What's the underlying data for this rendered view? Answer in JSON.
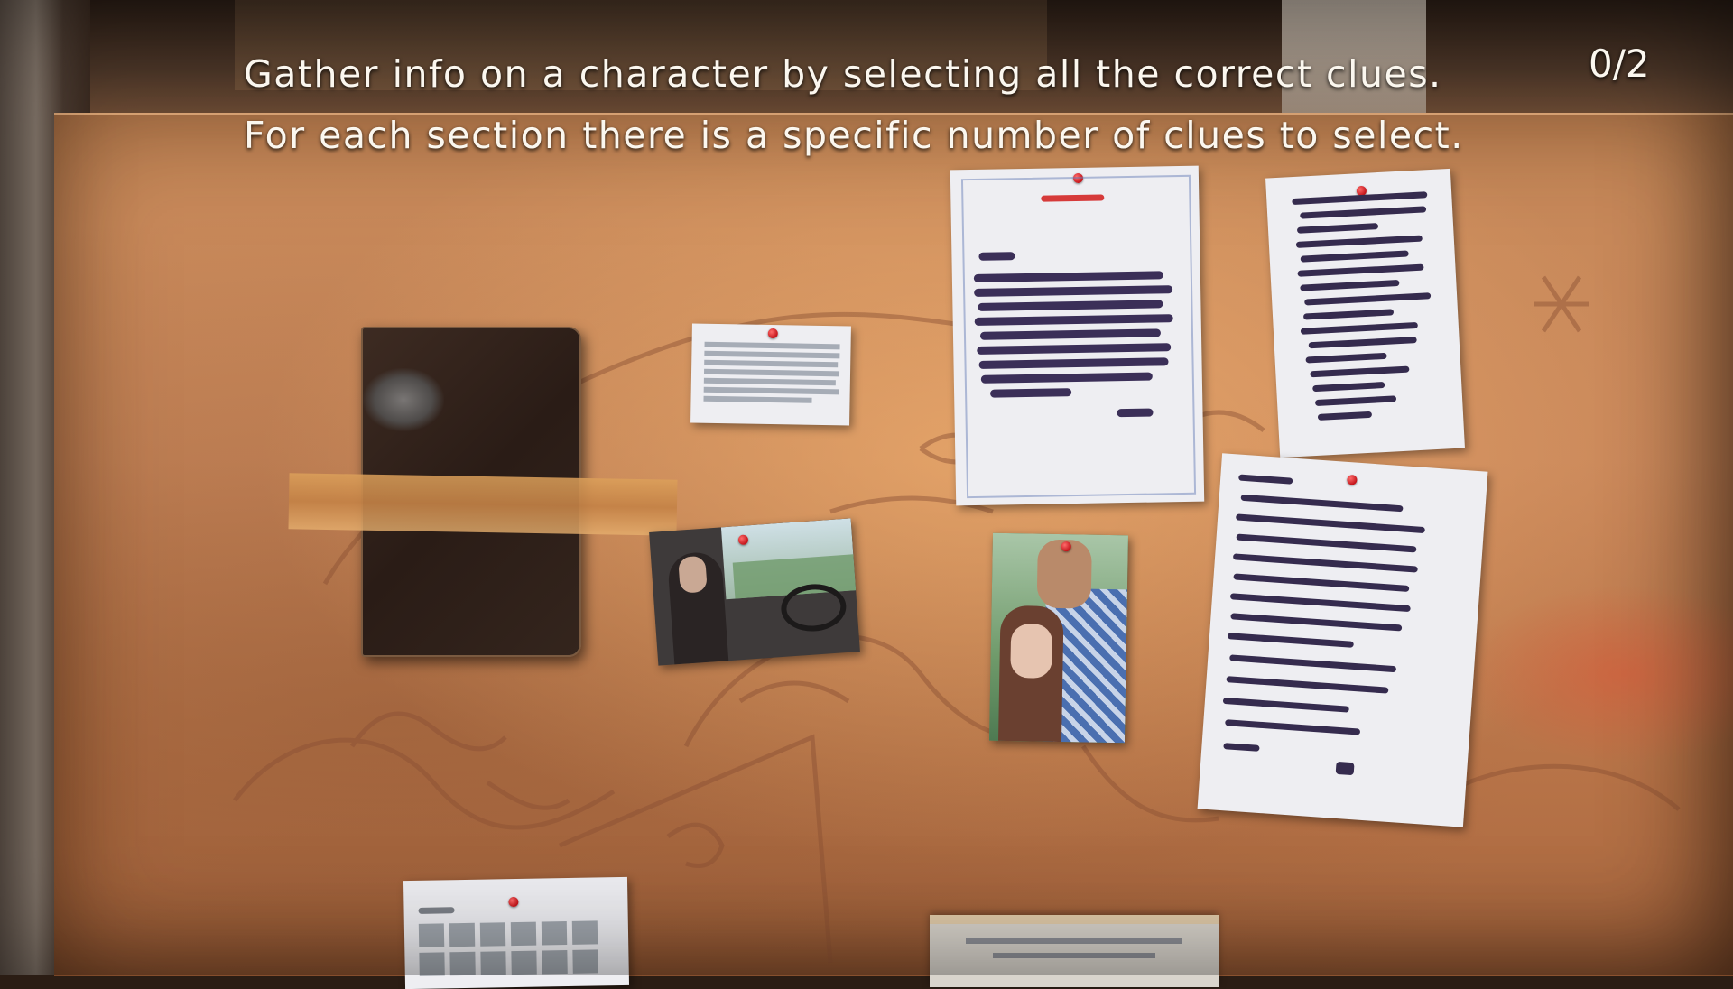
{
  "hud": {
    "instruction_line1": "Gather info on a character by selecting all the correct clues.",
    "instruction_line2": "For each section there is a specific number of clues to select.",
    "counter": "0/2"
  },
  "clues": [
    {
      "id": "taped-notebook",
      "icon": "notebook-icon"
    },
    {
      "id": "small-note"
    },
    {
      "id": "redacted-document"
    },
    {
      "id": "redacted-letter"
    },
    {
      "id": "car-photo"
    },
    {
      "id": "couple-photo"
    },
    {
      "id": "handwritten-list"
    },
    {
      "id": "calendar-page"
    },
    {
      "id": "bottom-document"
    }
  ],
  "colors": {
    "board": "#c88a5a",
    "pin": "#c4141a",
    "redaction_ink": "#3b2f58",
    "hud_text": "#fbf7ef"
  }
}
